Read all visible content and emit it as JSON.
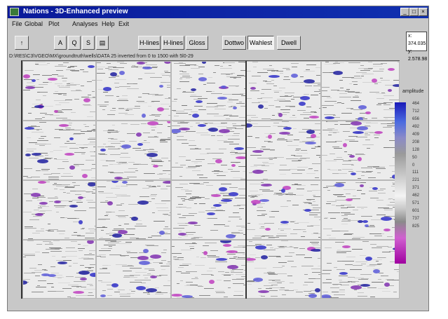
{
  "window": {
    "title": "Nations - 3D-Enhanced preview"
  },
  "controls": {
    "minimize": "_",
    "maximize": "□",
    "close": "×"
  },
  "menu": [
    "File",
    "Global",
    "Plot",
    "Analyses",
    "Help",
    "Exit"
  ],
  "toolbar": {
    "buttons_left": [
      "↑",
      "A",
      "Q",
      "S",
      "▤"
    ],
    "view_buttons": [
      "H-lines",
      "H-lines",
      "Gloss"
    ],
    "mode_buttons": [
      "Dottwo",
      "Wahlest",
      "Dwell"
    ]
  },
  "readout": {
    "line1": "x: 374.035",
    "line2": "y: 2.578.98"
  },
  "path": "D:\\RES\\C3\\VGEO\\MX\\groundtruth\\wells\\DATA 25 inverted from 0 to 1500 with 5l0-29",
  "colorbar": {
    "title": "amplitude",
    "labels": [
      "464",
      "712",
      "656",
      "492",
      "409",
      "208",
      "128",
      "50",
      "0",
      "111",
      "221",
      "371",
      "462",
      "571",
      "601",
      "737",
      "825"
    ],
    "colors": [
      "#1a1ab8",
      "#8a8ac8",
      "#f4f4f4",
      "#8a8a8a",
      "#a000a0"
    ]
  },
  "seismic": {
    "rows": 4,
    "cols": 5,
    "blob_colors": [
      "#3030c8",
      "#8030b0",
      "#c040c0",
      "#2020a0",
      "#5a5ad8"
    ]
  }
}
